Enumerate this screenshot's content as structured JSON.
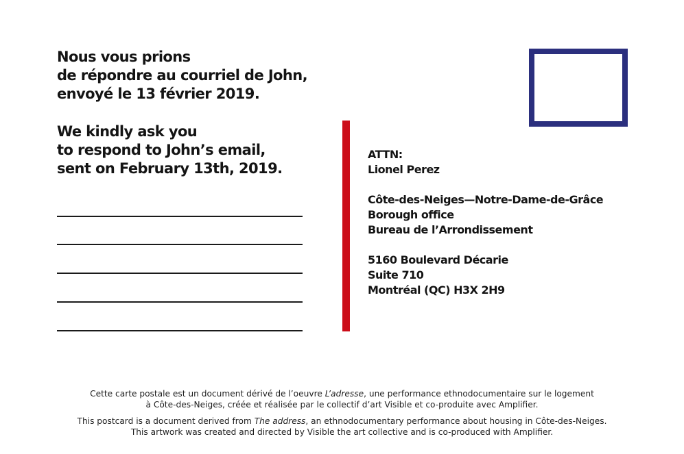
{
  "message": {
    "french": [
      "Nous vous prions",
      "de répondre au courriel de John,",
      "envoyé le 13 février 2019."
    ],
    "english": [
      "We kindly ask you",
      "to respond to John’s email,",
      "sent on February 13th, 2019."
    ]
  },
  "writing_lines": 5,
  "address": {
    "attn_label": "ATTN:",
    "recipient": "Lionel Perez",
    "office_lines": [
      "Côte-des-Neiges—Notre-Dame-de-Grâce",
      "Borough office",
      "Bureau de l’Arrondissement"
    ],
    "street_lines": [
      "5160 Boulevard Décarie",
      "Suite 710",
      "Montréal (QC) H3X 2H9"
    ]
  },
  "credits": {
    "french": {
      "line1_before": "Cette carte postale est un document dérivé de l’oeuvre ",
      "line1_title": "L’adresse",
      "line1_after": ", une performance ethnodocumentaire sur le logement",
      "line2": "à Côte-des-Neiges, créée et réalisée par le collectif d’art Visible et co-produite avec Amplifier."
    },
    "english": {
      "line1_before": "This postcard is a document derived from ",
      "line1_title": "The address",
      "line1_after": ", an ethnodocumentary performance about housing in Côte-des-Neiges.",
      "line2": "This artwork was created and directed by Visible the art collective and is co-produced with Amplifier."
    }
  },
  "colors": {
    "divider": "#cc0d19",
    "stamp_border": "#2b2f7e",
    "text": "#141414"
  }
}
